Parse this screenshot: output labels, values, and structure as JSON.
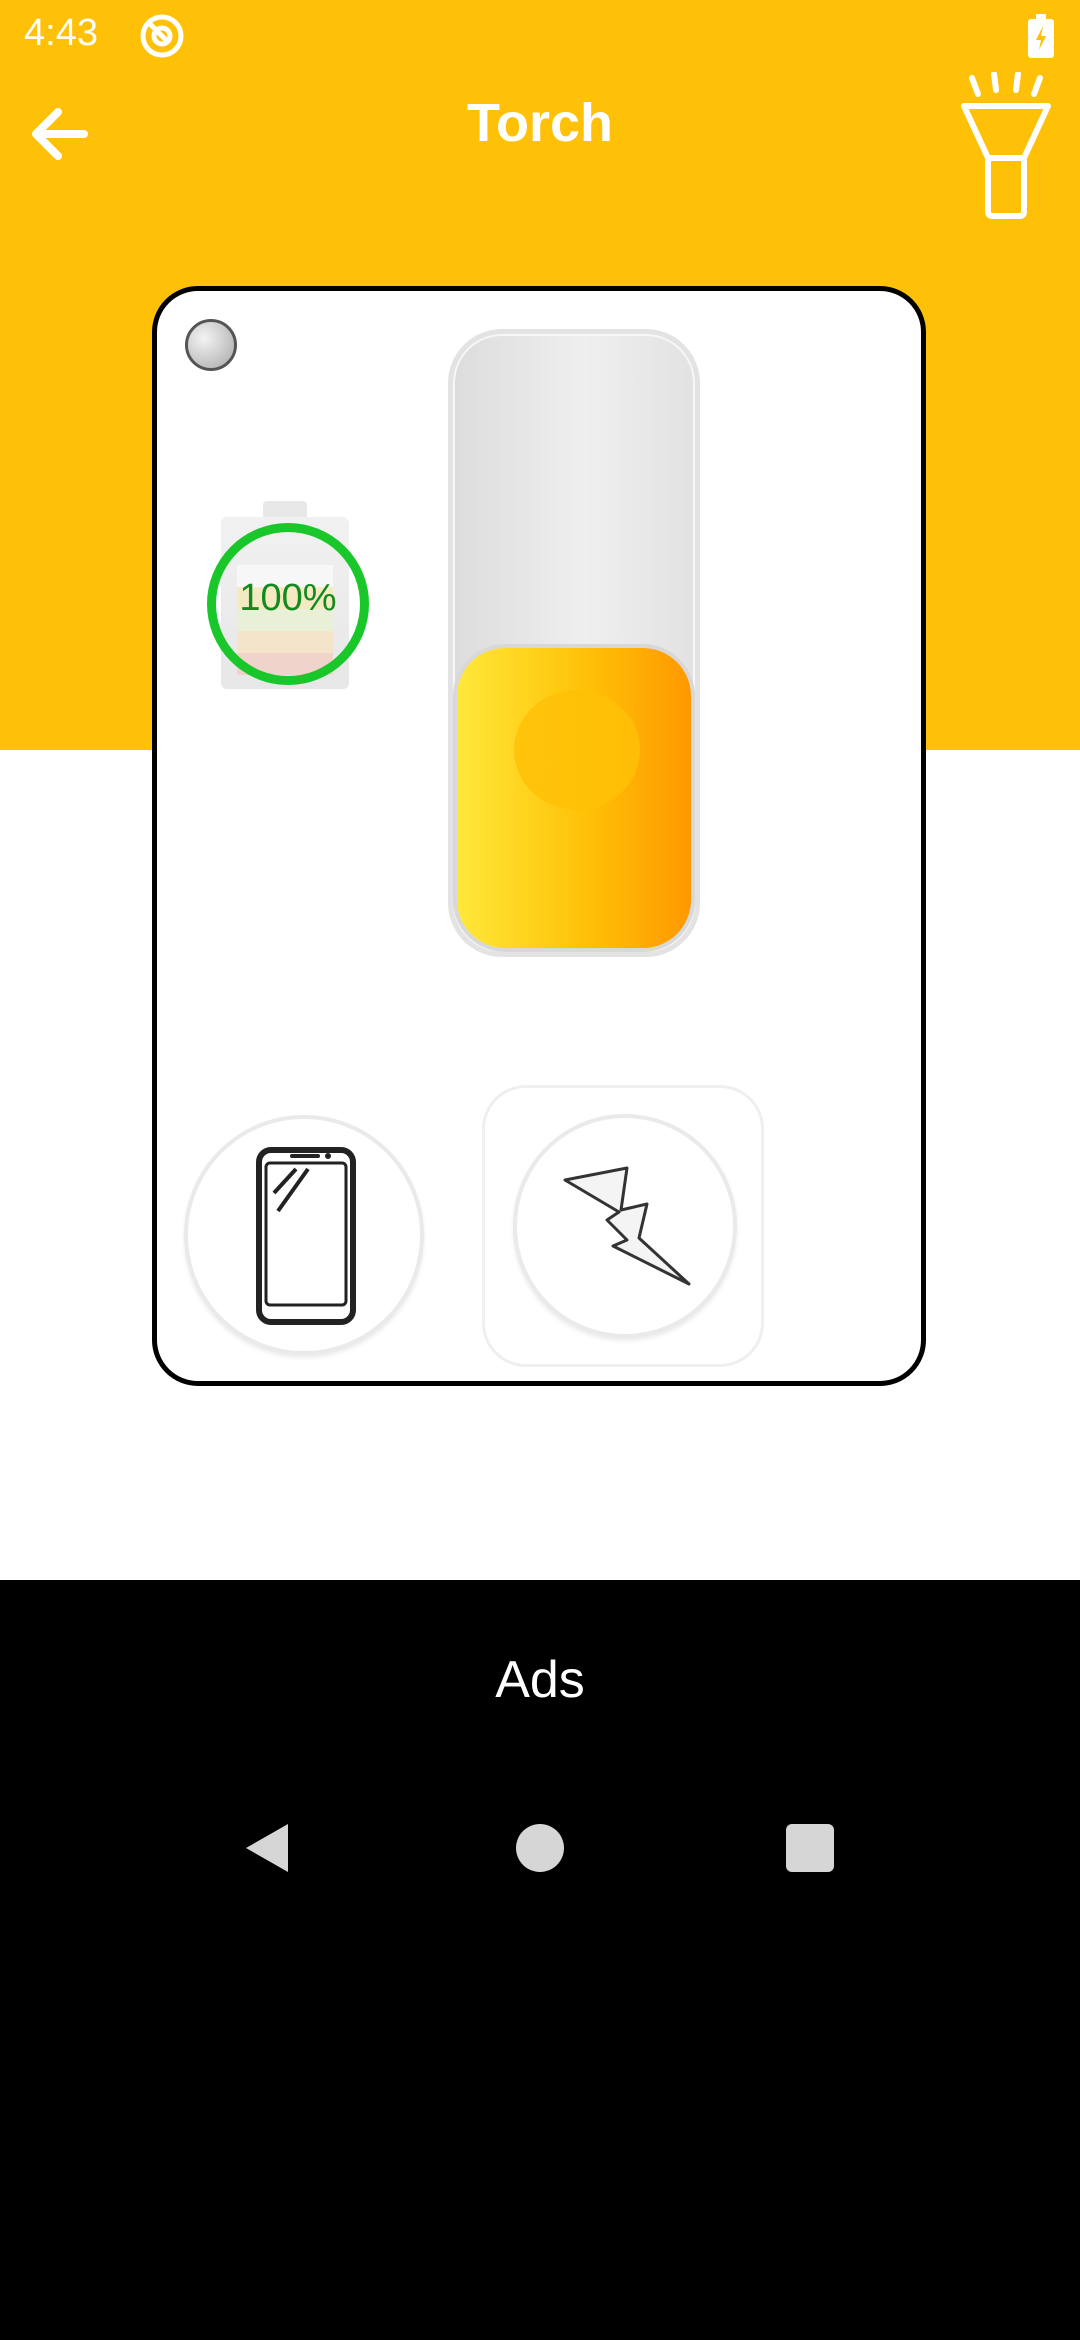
{
  "status_bar": {
    "time": "4:43",
    "battery_icon": "battery-charging-icon",
    "app_icon": "at-sign-icon"
  },
  "toolbar": {
    "title": "Torch",
    "back_icon": "arrow-left-icon",
    "action_icon": "flashlight-icon"
  },
  "card": {
    "battery": {
      "percent_text": "100%",
      "level": 1.0
    },
    "switch": {
      "state": "off"
    },
    "buttons": {
      "screen_light_icon": "phone-screen-icon",
      "strobe_icon": "lightning-icon"
    }
  },
  "ads": {
    "label": "Ads"
  },
  "colors": {
    "accent": "#FFC107",
    "battery_ring": "#19C72A",
    "knob_start": "#FFE83A",
    "knob_end": "#FF9800"
  }
}
